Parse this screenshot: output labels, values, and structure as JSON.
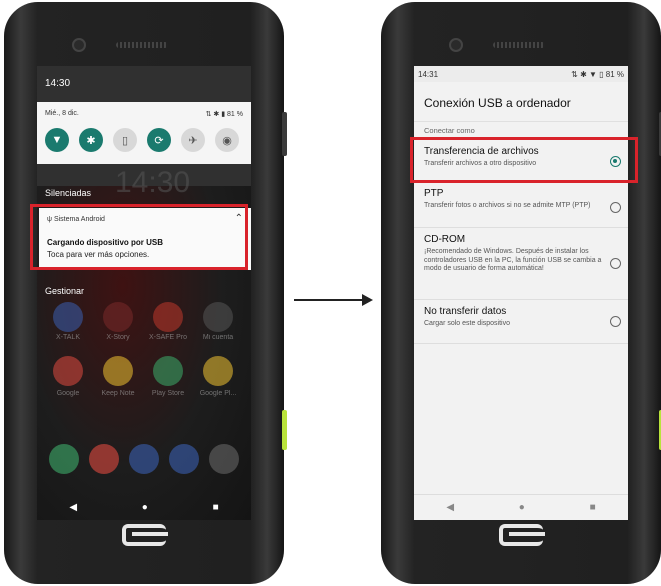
{
  "left_phone": {
    "status_time": "14:30",
    "quick_settings": {
      "date": "Mié., 8 dic.",
      "status": "⇅ ✱ ▮ 81 %",
      "tiles": [
        {
          "icon": "wifi-icon",
          "glyph": "▼",
          "on": true
        },
        {
          "icon": "bluetooth-icon",
          "glyph": "✱",
          "on": true
        },
        {
          "icon": "flashlight-icon",
          "glyph": "▯",
          "on": false
        },
        {
          "icon": "auto-rotate-icon",
          "glyph": "⟳",
          "on": true
        },
        {
          "icon": "airplane-icon",
          "glyph": "✈",
          "on": false
        },
        {
          "icon": "location-icon",
          "glyph": "◉",
          "on": false
        }
      ]
    },
    "background_clock": "14:30",
    "silenced_header": "Silenciadas",
    "notification": {
      "app_name": "Sistema Android",
      "title": "Cargando dispositivo por USB",
      "text": "Toca para ver más opciones."
    },
    "manage_label": "Gestionar",
    "apps_row1": [
      {
        "name": "X-TALK",
        "color": "#3b5fb0"
      },
      {
        "name": "X-Story",
        "color": "#7a2a2a"
      },
      {
        "name": "X-SAFE Pro",
        "color": "#c0392b"
      },
      {
        "name": "Mi cuenta",
        "color": "#555555"
      }
    ],
    "apps_row2": [
      {
        "name": "Google",
        "color": "#e04a3f"
      },
      {
        "name": "Keep Note",
        "color": "#f1c232"
      },
      {
        "name": "Play Store",
        "color": "#3dae6b"
      },
      {
        "name": "Google Pl...",
        "color": "#f1c232"
      }
    ],
    "dock_colors": [
      "#3dae6b",
      "#e04a3f",
      "#3b5fb0",
      "#3b5fb0",
      "#666666"
    ]
  },
  "right_phone": {
    "status_time": "14:31",
    "status_icons": "⇅ ✱ ▼ ▯ 81 %",
    "title": "Conexión USB a ordenador",
    "section": "Conectar como",
    "options": [
      {
        "title": "Transferencia de archivos",
        "sub": "Transferir archivos a otro dispositivo",
        "selected": true
      },
      {
        "title": "PTP",
        "sub": "Transferir fotos o archivos si no se admite MTP (PTP)",
        "selected": false
      },
      {
        "title": "CD-ROM",
        "sub": "¡Recomendado de Windows. Después de instalar los controladores USB en la PC, la función USB se cambia a modo de usuario de forma automática!",
        "selected": false
      },
      {
        "title": "No transferir datos",
        "sub": "Cargar solo este dispositivo",
        "selected": false
      }
    ]
  },
  "colors": {
    "highlight": "#d9232b",
    "accent": "#1a7a6e",
    "phone_green": "#b9e33b"
  }
}
